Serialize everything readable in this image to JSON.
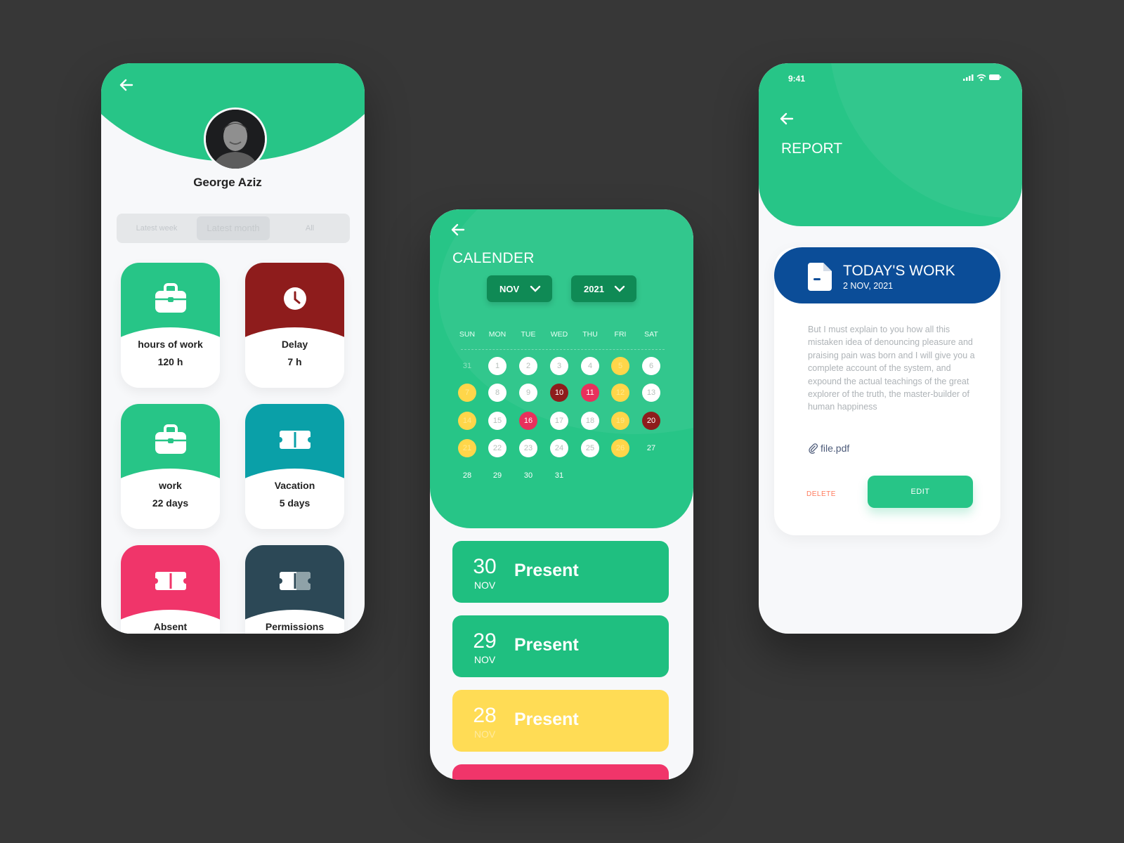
{
  "colors": {
    "green": "#27c587",
    "dark_red": "#8e1c1c",
    "teal": "#0aa0a8",
    "pink": "#f0356a",
    "slate": "#2c4856",
    "yellow": "#ffdc55",
    "navy": "#0b4d98",
    "background": "#373737"
  },
  "profile": {
    "back_icon": "arrow-left-icon",
    "name": "George Aziz",
    "segments": [
      "Latest week",
      "Latest month",
      "All"
    ],
    "tiles": [
      {
        "label": "hours of work",
        "value": "120 h",
        "icon": "briefcase-icon",
        "color": "#27c587"
      },
      {
        "label": "Delay",
        "value": "7 h",
        "icon": "clock-icon",
        "color": "#8e1c1c"
      },
      {
        "label": "work",
        "value": "22 days",
        "icon": "briefcase-icon",
        "color": "#27c587"
      },
      {
        "label": "Vacation",
        "value": "5 days",
        "icon": "ticket-icon",
        "color": "#0aa0a8"
      },
      {
        "label": "Absent",
        "value": "",
        "icon": "ticket-icon",
        "color": "#f0356a"
      },
      {
        "label": "Permissions",
        "value": "",
        "icon": "ticket-icon",
        "color": "#2c4856"
      }
    ]
  },
  "calendar": {
    "title": "CALENDER",
    "month": "NOV",
    "year": "2021",
    "weekdays": [
      "SUN",
      "MON",
      "TUE",
      "WED",
      "THU",
      "FRI",
      "SAT"
    ],
    "weeks": [
      [
        {
          "d": "31",
          "s": "faded"
        },
        {
          "d": "1",
          "s": "white"
        },
        {
          "d": "2",
          "s": "white"
        },
        {
          "d": "3",
          "s": "white"
        },
        {
          "d": "4",
          "s": "white"
        },
        {
          "d": "5",
          "s": "yellow"
        },
        {
          "d": "6",
          "s": "white"
        }
      ],
      [
        {
          "d": "7",
          "s": "yellow"
        },
        {
          "d": "8",
          "s": "white"
        },
        {
          "d": "9",
          "s": "white"
        },
        {
          "d": "10",
          "s": "dark"
        },
        {
          "d": "11",
          "s": "red"
        },
        {
          "d": "12",
          "s": "yellow"
        },
        {
          "d": "13",
          "s": "white"
        }
      ],
      [
        {
          "d": "14",
          "s": "yellow"
        },
        {
          "d": "15",
          "s": "white"
        },
        {
          "d": "16",
          "s": "red"
        },
        {
          "d": "17",
          "s": "white"
        },
        {
          "d": "18",
          "s": "white"
        },
        {
          "d": "19",
          "s": "yellow"
        },
        {
          "d": "20",
          "s": "dark"
        }
      ],
      [
        {
          "d": "21",
          "s": "yellow"
        },
        {
          "d": "22",
          "s": "white"
        },
        {
          "d": "23",
          "s": "white"
        },
        {
          "d": "24",
          "s": "white"
        },
        {
          "d": "25",
          "s": "white"
        },
        {
          "d": "26",
          "s": "yellow"
        },
        {
          "d": "27",
          "s": "plain"
        }
      ],
      [
        {
          "d": "28",
          "s": "plain"
        },
        {
          "d": "29",
          "s": "plain"
        },
        {
          "d": "30",
          "s": "plain"
        },
        {
          "d": "31",
          "s": "plain"
        }
      ]
    ],
    "attendance": [
      {
        "day": "30",
        "month": "NOV",
        "status": "Present",
        "color": "#1fbf80"
      },
      {
        "day": "29",
        "month": "NOV",
        "status": "Present",
        "color": "#1fbf80"
      },
      {
        "day": "28",
        "month": "NOV",
        "status": "Present",
        "color": "#ffdc55"
      },
      {
        "day": "",
        "month": "",
        "status": "",
        "color": "#f0356a"
      }
    ]
  },
  "report": {
    "status_time": "9:41",
    "title": "REPORT",
    "banner_title": "TODAY'S WORK",
    "banner_date": "2 NOV, 2021",
    "body": "But I must explain to you how all this mistaken idea of denouncing pleasure and praising pain was born and I will give you a complete account of the system, and expound the actual teachings of the great explorer of the truth, the master-builder of human happiness",
    "attachment": "file.pdf",
    "delete_label": "DELETE",
    "edit_label": "EDIT"
  }
}
